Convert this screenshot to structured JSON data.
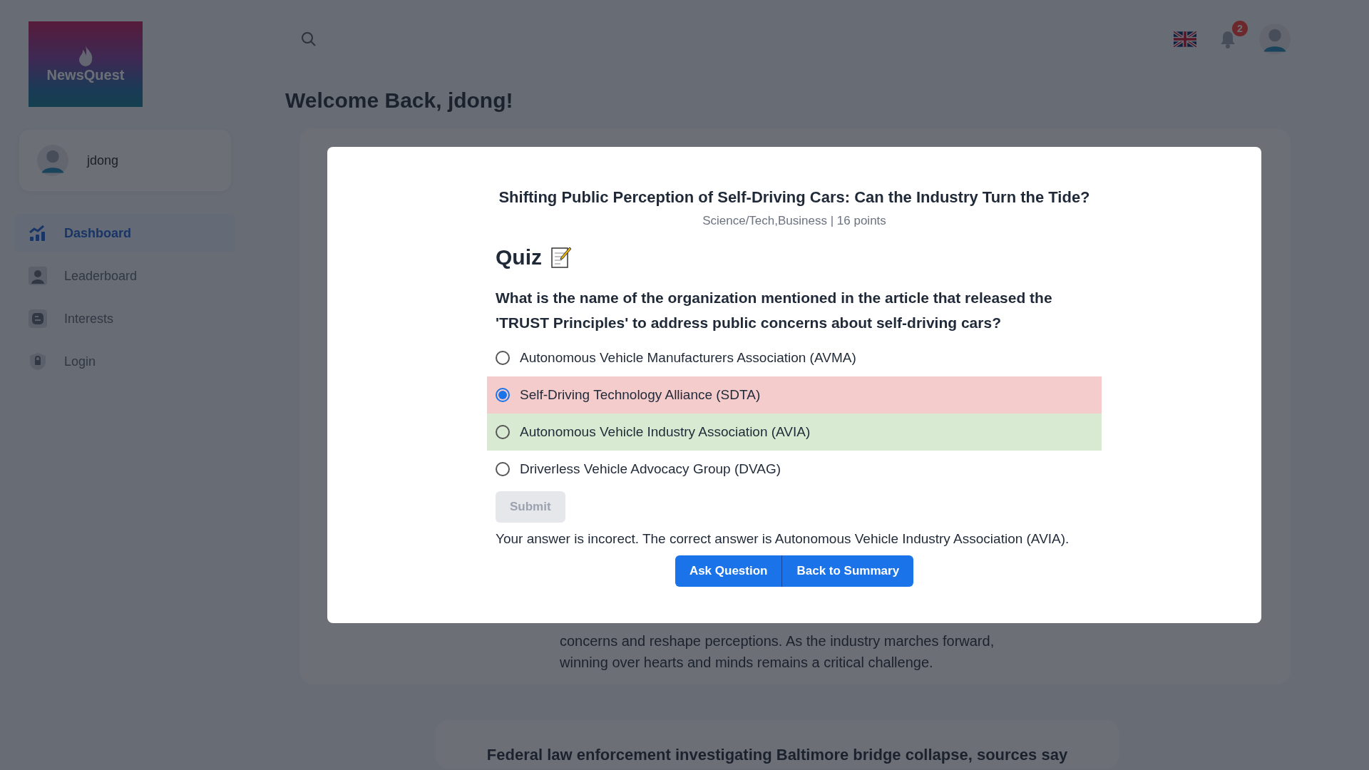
{
  "sidebar": {
    "logo": "NewsQuest",
    "user": {
      "name": "jdong"
    },
    "nav": [
      {
        "label": "Dashboard",
        "selected": true
      },
      {
        "label": "Leaderboard",
        "selected": false
      },
      {
        "label": "Interests",
        "selected": false
      },
      {
        "label": "Login",
        "selected": false
      }
    ]
  },
  "header": {
    "notification_count": "2"
  },
  "welcome": "Welcome Back, jdong!",
  "background_article": {
    "lines": [
      "concerns and reshape perceptions. As the industry marches forward,",
      "winning over hearts and minds remains a critical challenge."
    ],
    "next_title": "Federal law enforcement investigating Baltimore bridge collapse, sources say"
  },
  "modal": {
    "title": "Shifting Public Perception of Self-Driving Cars: Can the Industry Turn the Tide?",
    "meta": "Science/Tech,Business | 16 points",
    "quiz_heading": "Quiz",
    "question": "What is the name of the organization mentioned in the article that released the 'TRUST Principles' to address public concerns about self-driving cars?",
    "options": [
      {
        "label": "Autonomous Vehicle Manufacturers Association (AVMA)",
        "selected": false,
        "kind": "plain"
      },
      {
        "label": "Self-Driving Technology Alliance (SDTA)",
        "selected": true,
        "kind": "incorrect"
      },
      {
        "label": "Autonomous Vehicle Industry Association (AVIA)",
        "selected": false,
        "kind": "correct"
      },
      {
        "label": "Driverless Vehicle Advocacy Group (DVAG)",
        "selected": false,
        "kind": "plain"
      }
    ],
    "submit": {
      "label": "Submit",
      "disabled": true
    },
    "result": "Your answer is incorect. The correct answer is Autonomous Vehicle Industry Association (AVIA).",
    "actions": [
      "Ask Question",
      "Back to Summary"
    ]
  }
}
